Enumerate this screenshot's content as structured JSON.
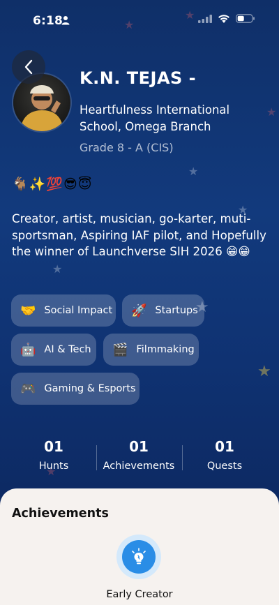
{
  "status_bar": {
    "time": "6:18"
  },
  "profile": {
    "name": "K.N. TEJAS -",
    "school": "Heartfulness International School, Omega Branch",
    "grade": "Grade 8 - A (CIS)",
    "emojis": "🐐✨💯😎😇",
    "bio": "Creator, artist, musician, go-karter, muti-sportsman, Aspiring IAF pilot, and Hopefully the winner of Launchverse SIH 2026 😁😁"
  },
  "interests": [
    {
      "icon": "🤝",
      "label": "Social Impact",
      "icon_name": "handshake-icon"
    },
    {
      "icon": "🚀",
      "label": "Startups",
      "icon_name": "rocket-icon"
    },
    {
      "icon": "🤖",
      "label": "AI & Tech",
      "icon_name": "robot-icon"
    },
    {
      "icon": "🎬",
      "label": "Filmmaking",
      "icon_name": "clapperboard-icon"
    },
    {
      "icon": "🎮",
      "label": "Gaming & Esports",
      "icon_name": "gamepad-icon"
    }
  ],
  "stats": [
    {
      "value": "01",
      "label": "Hunts"
    },
    {
      "value": "01",
      "label": "Achievements"
    },
    {
      "value": "01",
      "label": "Quests"
    }
  ],
  "achievements": {
    "title": "Achievements",
    "items": [
      {
        "label": "Early Creator",
        "icon_name": "lightbulb-icon"
      }
    ]
  },
  "colors": {
    "background_top": "#0f2f68",
    "background_bottom": "#0b2357",
    "chip": "rgba(255,255,255,0.2)",
    "sheet": "#f6f2ef",
    "badge_ring": "#d4e9fb",
    "badge_core": "#2a8de6"
  }
}
